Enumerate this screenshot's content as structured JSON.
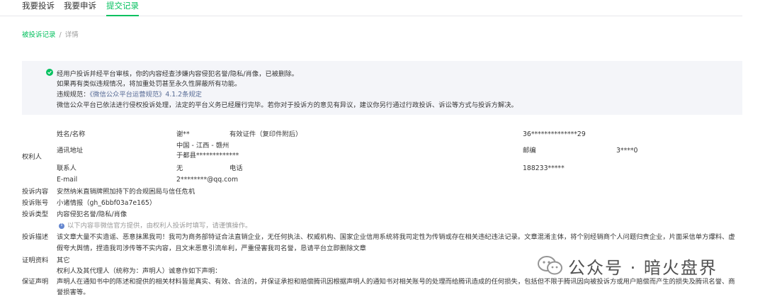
{
  "tabs": [
    {
      "label": "我要投诉"
    },
    {
      "label": "我要申诉"
    },
    {
      "label": "提交记录"
    }
  ],
  "breadcrumb": {
    "parent": "被投诉记录",
    "separator": "/",
    "current": "详情"
  },
  "notice": {
    "line1": "经用户投诉并经平台审核，你的内容经查涉嫌内容侵犯名誉/隐私/肖像，已被删除。",
    "line2": "如果再有类似违规情况，将加重处罚甚至永久性屏蔽所有功能。",
    "rule_label": "违规规范：",
    "rule_link": "《微信公众平台运营规范》4.1.2条规定",
    "line4": "微信公众平台已依法进行侵权投诉处理，法定的平台义务已经履行完毕。若你对于投诉方的意见有异议，建议你另行通过行政投诉、诉讼等方式与投诉方解决。"
  },
  "rights_holder": {
    "section_label": "权利人",
    "name_label": "姓名/名称",
    "name_value": "谢**",
    "id_label": "有效证件（复印件附后）",
    "id_value": "36**************29",
    "address_label": "通讯地址",
    "address_line1": "中国 - 江西 - 赣州",
    "address_line2": "于都县*************",
    "postcode_label": "邮编",
    "postcode_value": "3****0",
    "contact_label": "联系人",
    "contact_value": "无",
    "phone_label": "电话",
    "phone_value": "188233*****",
    "email_label": "E-mail",
    "email_value": "2********@qq.com"
  },
  "complaint": {
    "content_label": "投诉内容",
    "content_value": "安然纳米直销牌照加持下的合规困局与信任危机",
    "account_label": "投诉账号",
    "account_value": "小诸情报（gh_6bbf03a7e165）",
    "type_label": "投诉类型",
    "type_value": "内容侵犯名誉/隐私/肖像",
    "type_hint": "以下内容非微信官方提供，由权利人投诉时填写，请谨慎操作。",
    "desc_label": "投诉描述",
    "desc_line1": "该文章大量不实造谣、恶意抹黑我司！我司为商务部特证合法直销企业，无任何执法、权威机构、国家企业信用系统将我司定性为传销或存在相关违纪违法记录。文章混淆主体，将个别经销商个人问题归责企业，片面采信单方爆料、虚",
    "desc_line2": "假夸大舆情，捏造我司涉传等不实内容，且文末恶意引流牟利，严重侵害我司名誉，恳请平台立即删除文章",
    "proof_label": "证明资料",
    "proof_value": "其它",
    "statement_label": "保证声明",
    "statement_line1": "权利人及其代理人（统称为：声明人）诚意作如下声明：",
    "statement_line2": "声明人在通知书中的陈述和提供的相关材料皆是真实、有效、合法的，并保证承担和赔偿腾讯因根据声明人的通知书对相关账号的处理而给腾讯造成的任何损失，包括但不限于腾讯因向被投诉方或用户赔偿而产生的损失及腾讯名誉、商",
    "statement_line3": "誉损害等。"
  },
  "watermark": {
    "text": "公众号 · 暗火盘界"
  },
  "colors": {
    "accent": "#07c160",
    "link": "#576b95",
    "notice_bg": "#f4f5f9"
  }
}
